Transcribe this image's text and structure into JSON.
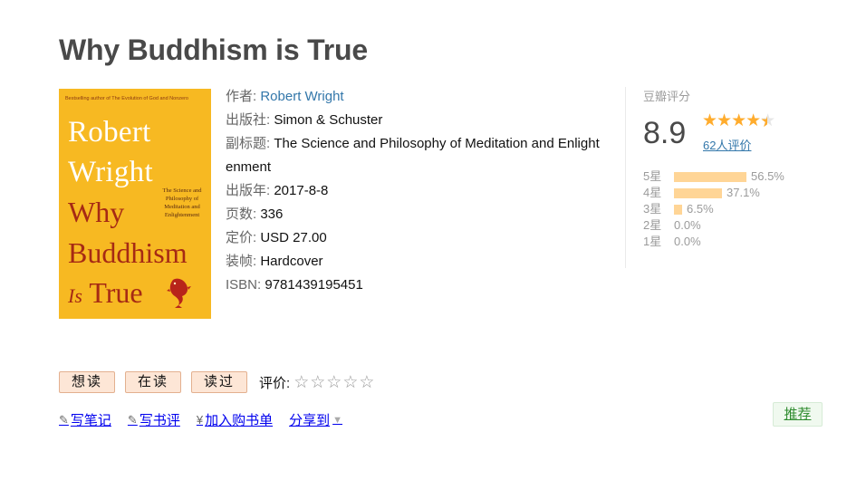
{
  "title": "Why Buddhism is True",
  "cover": {
    "tagline": "Bestselling author of The Evolution of God and Nonzero",
    "author_line1": "Robert",
    "author_line2": "Wright",
    "title_line1": "Why",
    "title_line2": "Buddhism",
    "title_line3_small": "Is",
    "title_line3": "True",
    "subtitle": "The Science and Philosophy of Meditation and Enlightenment"
  },
  "info": {
    "author_label": "作者:",
    "author_value": "Robert Wright",
    "publisher_label": "出版社:",
    "publisher_value": "Simon & Schuster",
    "subtitle_label": "副标题:",
    "subtitle_value": "The Science and Philosophy of Meditation and Enlightenment",
    "year_label": "出版年:",
    "year_value": "2017-8-8",
    "pages_label": "页数:",
    "pages_value": "336",
    "price_label": "定价:",
    "price_value": "USD 27.00",
    "binding_label": "装帧:",
    "binding_value": "Hardcover",
    "isbn_label": "ISBN:",
    "isbn_value": "9781439195451"
  },
  "rating": {
    "header": "豆瓣评分",
    "score": "8.9",
    "score_value": 8.9,
    "count": "62人评价",
    "distribution": [
      {
        "label": "5星",
        "percent": "56.5%",
        "value": 56.5
      },
      {
        "label": "4星",
        "percent": "37.1%",
        "value": 37.1
      },
      {
        "label": "3星",
        "percent": "6.5%",
        "value": 6.5
      },
      {
        "label": "2星",
        "percent": "0.0%",
        "value": 0.0
      },
      {
        "label": "1星",
        "percent": "0.0%",
        "value": 0.0
      }
    ],
    "bar_color": "#ffd596",
    "star_color": "#ffac2d"
  },
  "buttons": {
    "want": "想读",
    "reading": "在读",
    "read": "读过",
    "rate_label": "评价:",
    "user_stars": "☆☆☆☆☆"
  },
  "actions": {
    "note": "写笔记",
    "review": "写书评",
    "cart": "加入购书单",
    "share": "分享到"
  },
  "recommend": "推荐",
  "colors": {
    "link": "#3377aa",
    "cover_bg": "#f7b922",
    "cover_title": "#a62a14"
  }
}
